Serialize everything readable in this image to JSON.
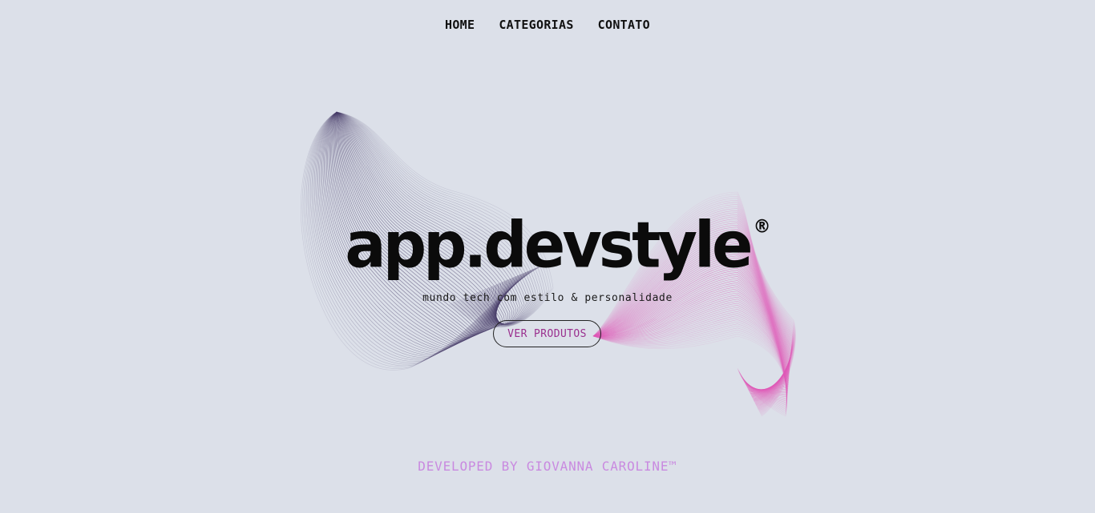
{
  "nav": {
    "items": [
      {
        "label": "HOME"
      },
      {
        "label": "CATEGORIAS"
      },
      {
        "label": "CONTATO"
      }
    ]
  },
  "hero": {
    "logo_text": "app.devstyle",
    "logo_mark": "®",
    "tagline": "mundo tech com estilo & personalidade",
    "cta_label": "VER PRODUTOS"
  },
  "footer": {
    "credit": "DEVELOPED BY GIOVANNA CAROLINE™"
  },
  "colors": {
    "background": "#dce0e9",
    "wave_left": "#4a3f6b",
    "wave_right": "#e05ab8",
    "cta_text": "#9a2f8e",
    "footer_text": "#c98ae0"
  },
  "icons": {
    "decoration": "wave-mesh-illustration"
  }
}
